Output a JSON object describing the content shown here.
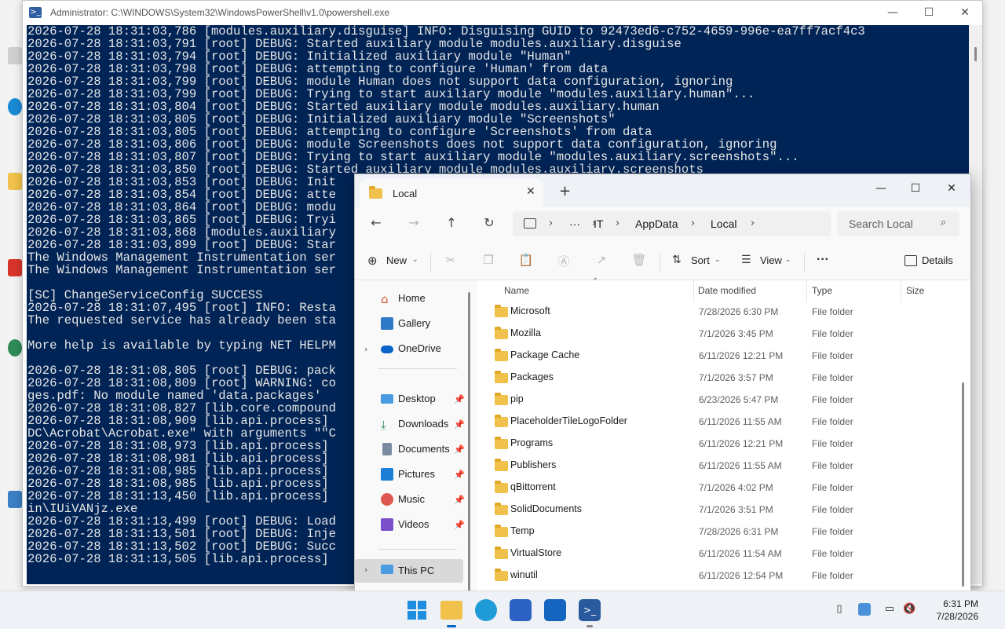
{
  "powershell": {
    "title": "Administrator: C:\\WINDOWS\\System32\\WindowsPowerShell\\v1.0\\powershell.exe",
    "icon": "powershell-icon",
    "console_lines": [
      "2026-07-28 18:31:03,786 [modules.auxiliary.disguise] INFO: Disguising GUID to 92473ed6-c752-4659-996e-ea7ff7acf4c3",
      "2026-07-28 18:31:03,791 [root] DEBUG: Started auxiliary module modules.auxiliary.disguise",
      "2026-07-28 18:31:03,794 [root] DEBUG: Initialized auxiliary module \"Human\"",
      "2026-07-28 18:31:03,798 [root] DEBUG: attempting to configure 'Human' from data",
      "2026-07-28 18:31:03,799 [root] DEBUG: module Human does not support data configuration, ignoring",
      "2026-07-28 18:31:03,799 [root] DEBUG: Trying to start auxiliary module \"modules.auxiliary.human\"...",
      "2026-07-28 18:31:03,804 [root] DEBUG: Started auxiliary module modules.auxiliary.human",
      "2026-07-28 18:31:03,805 [root] DEBUG: Initialized auxiliary module \"Screenshots\"",
      "2026-07-28 18:31:03,805 [root] DEBUG: attempting to configure 'Screenshots' from data",
      "2026-07-28 18:31:03,806 [root] DEBUG: module Screenshots does not support data configuration, ignoring",
      "2026-07-28 18:31:03,807 [root] DEBUG: Trying to start auxiliary module \"modules.auxiliary.screenshots\"...",
      "2026-07-28 18:31:03,850 [root] DEBUG: Started auxiliary module modules.auxiliary.screenshots",
      "2026-07-28 18:31:03,853 [root] DEBUG: Init",
      "2026-07-28 18:31:03,854 [root] DEBUG: atte",
      "2026-07-28 18:31:03,864 [root] DEBUG: modu",
      "2026-07-28 18:31:03,865 [root] DEBUG: Tryi",
      "2026-07-28 18:31:03,868 [modules.auxiliary",
      "2026-07-28 18:31:03,899 [root] DEBUG: Star",
      "The Windows Management Instrumentation ser",
      "The Windows Management Instrumentation ser",
      "",
      "[SC] ChangeServiceConfig SUCCESS",
      "2026-07-28 18:31:07,495 [root] INFO: Resta",
      "The requested service has already been sta",
      "",
      "More help is available by typing NET HELPM",
      "",
      "2026-07-28 18:31:08,805 [root] DEBUG: pack",
      "2026-07-28 18:31:08,809 [root] WARNING: co",
      "ges.pdf: No module named 'data.packages'",
      "2026-07-28 18:31:08,827 [lib.core.compound",
      "2026-07-28 18:31:08,909 [lib.api.process]",
      "DC\\Acrobat\\Acrobat.exe\" with arguments \"\"C",
      "2026-07-28 18:31:08,973 [lib.api.process]",
      "2026-07-28 18:31:08,981 [lib.api.process]",
      "2026-07-28 18:31:08,985 [lib.api.process]",
      "2026-07-28 18:31:08,985 [lib.api.process]",
      "2026-07-28 18:31:13,450 [lib.api.process]",
      "in\\IUiVANjz.exe",
      "2026-07-28 18:31:13,499 [root] DEBUG: Load",
      "2026-07-28 18:31:13,501 [root] DEBUG: Inje",
      "2026-07-28 18:31:13,502 [root] DEBUG: Succ",
      "2026-07-28 18:31:13,505 [lib.api.process]"
    ],
    "colors": {
      "console_bg": "#012456",
      "console_fg": "#e6e6e6"
    }
  },
  "explorer": {
    "tab_label": "Local",
    "tab_icon": "folder-icon",
    "address": {
      "root_icon": "computer-icon",
      "overflow": "···",
      "segments": [
        "IT",
        "AppData",
        "Local"
      ]
    },
    "search_placeholder": "Search Local",
    "toolbar": {
      "new_label": "New",
      "sort_label": "Sort",
      "view_label": "View",
      "more_label": "···",
      "details_label": "Details"
    },
    "nav": {
      "home": "Home",
      "gallery": "Gallery",
      "onedrive": "OneDrive",
      "desktop": "Desktop",
      "downloads": "Downloads",
      "documents": "Documents",
      "pictures": "Pictures",
      "music": "Music",
      "videos": "Videos",
      "thispc": "This PC"
    },
    "columns": {
      "name": "Name",
      "date": "Date modified",
      "type": "Type",
      "size": "Size"
    },
    "rows": [
      {
        "name": "Microsoft",
        "date": "7/28/2026 6:30 PM",
        "type": "File folder"
      },
      {
        "name": "Mozilla",
        "date": "7/1/2026 3:45 PM",
        "type": "File folder"
      },
      {
        "name": "Package Cache",
        "date": "6/11/2026 12:21 PM",
        "type": "File folder"
      },
      {
        "name": "Packages",
        "date": "7/1/2026 3:57 PM",
        "type": "File folder"
      },
      {
        "name": "pip",
        "date": "6/23/2026 5:47 PM",
        "type": "File folder"
      },
      {
        "name": "PlaceholderTileLogoFolder",
        "date": "6/11/2026 11:55 AM",
        "type": "File folder"
      },
      {
        "name": "Programs",
        "date": "6/11/2026 12:21 PM",
        "type": "File folder"
      },
      {
        "name": "Publishers",
        "date": "6/11/2026 11:55 AM",
        "type": "File folder"
      },
      {
        "name": "qBittorrent",
        "date": "7/1/2026 4:02 PM",
        "type": "File folder"
      },
      {
        "name": "SolidDocuments",
        "date": "7/1/2026 3:51 PM",
        "type": "File folder"
      },
      {
        "name": "Temp",
        "date": "7/28/2026 6:31 PM",
        "type": "File folder"
      },
      {
        "name": "VirtualStore",
        "date": "6/11/2026 11:54 AM",
        "type": "File folder"
      },
      {
        "name": "winutil",
        "date": "6/11/2026 12:54 PM",
        "type": "File folder"
      }
    ]
  },
  "taskbar": {
    "apps": [
      "start-icon",
      "file-explorer-icon",
      "edge-icon",
      "store-icon",
      "outlook-icon",
      "powershell-icon"
    ],
    "clock_time": "6:31 PM",
    "clock_date": "7/28/2026"
  },
  "colors": {
    "accent": "#0067c0",
    "folder": "#f0c14b"
  }
}
